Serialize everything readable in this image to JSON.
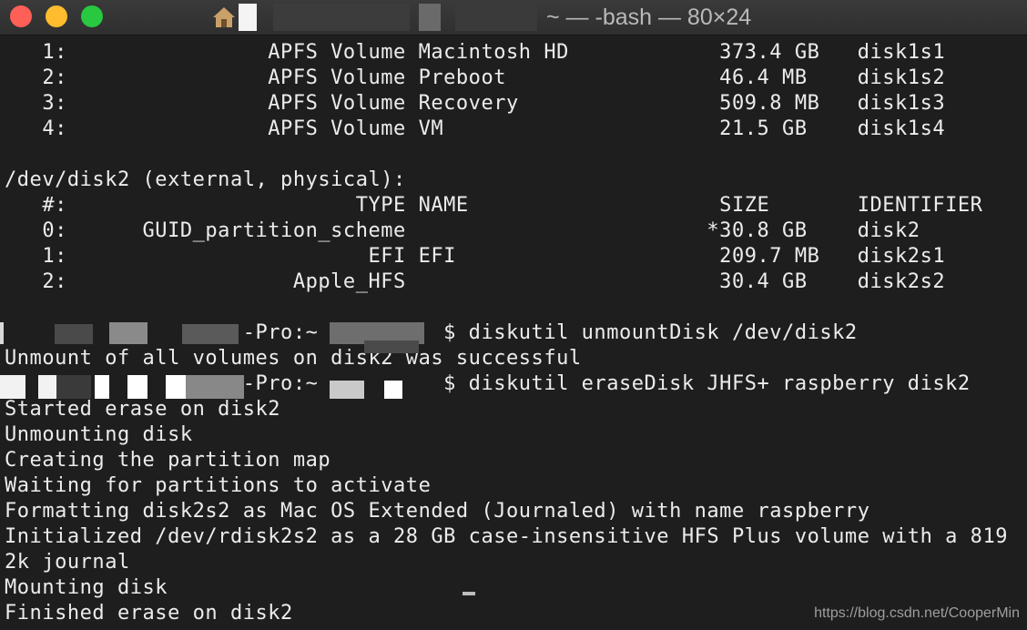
{
  "window": {
    "title": "~ — -bash — 80×24"
  },
  "terminal": {
    "lines": [
      "   1:                APFS Volume Macintosh HD            373.4 GB   disk1s1",
      "   2:                APFS Volume Preboot                 46.4 MB    disk1s2",
      "   3:                APFS Volume Recovery                509.8 MB   disk1s3",
      "   4:                APFS Volume VM                      21.5 GB    disk1s4",
      "",
      "/dev/disk2 (external, physical):",
      "   #:                       TYPE NAME                    SIZE       IDENTIFIER",
      "   0:      GUID_partition_scheme                        *30.8 GB    disk2",
      "   1:                        EFI EFI                     209.7 MB   disk2s1",
      "   2:                  Apple_HFS                         30.4 GB    disk2s2",
      "",
      "                   -Pro:~          $ diskutil unmountDisk /dev/disk2",
      "Unmount of all volumes on disk2 was successful",
      "                   -Pro:~          $ diskutil eraseDisk JHFS+ raspberry disk2",
      "Started erase on disk2",
      "Unmounting disk",
      "Creating the partition map",
      "Waiting for partitions to activate",
      "Formatting disk2s2 as Mac OS Extended (Journaled) with name raspberry",
      "Initialized /dev/rdisk2s2 as a 28 GB case-insensitive HFS Plus volume with a 819",
      "2k journal",
      "Mounting disk",
      "Finished erase on disk2"
    ]
  },
  "watermark": "https://blog.csdn.net/CooperMin",
  "colors": {
    "background": "#1e1e1e",
    "text": "#ececec",
    "close": "#fe5f57",
    "minimize": "#febc2e",
    "maximize": "#28c840"
  }
}
